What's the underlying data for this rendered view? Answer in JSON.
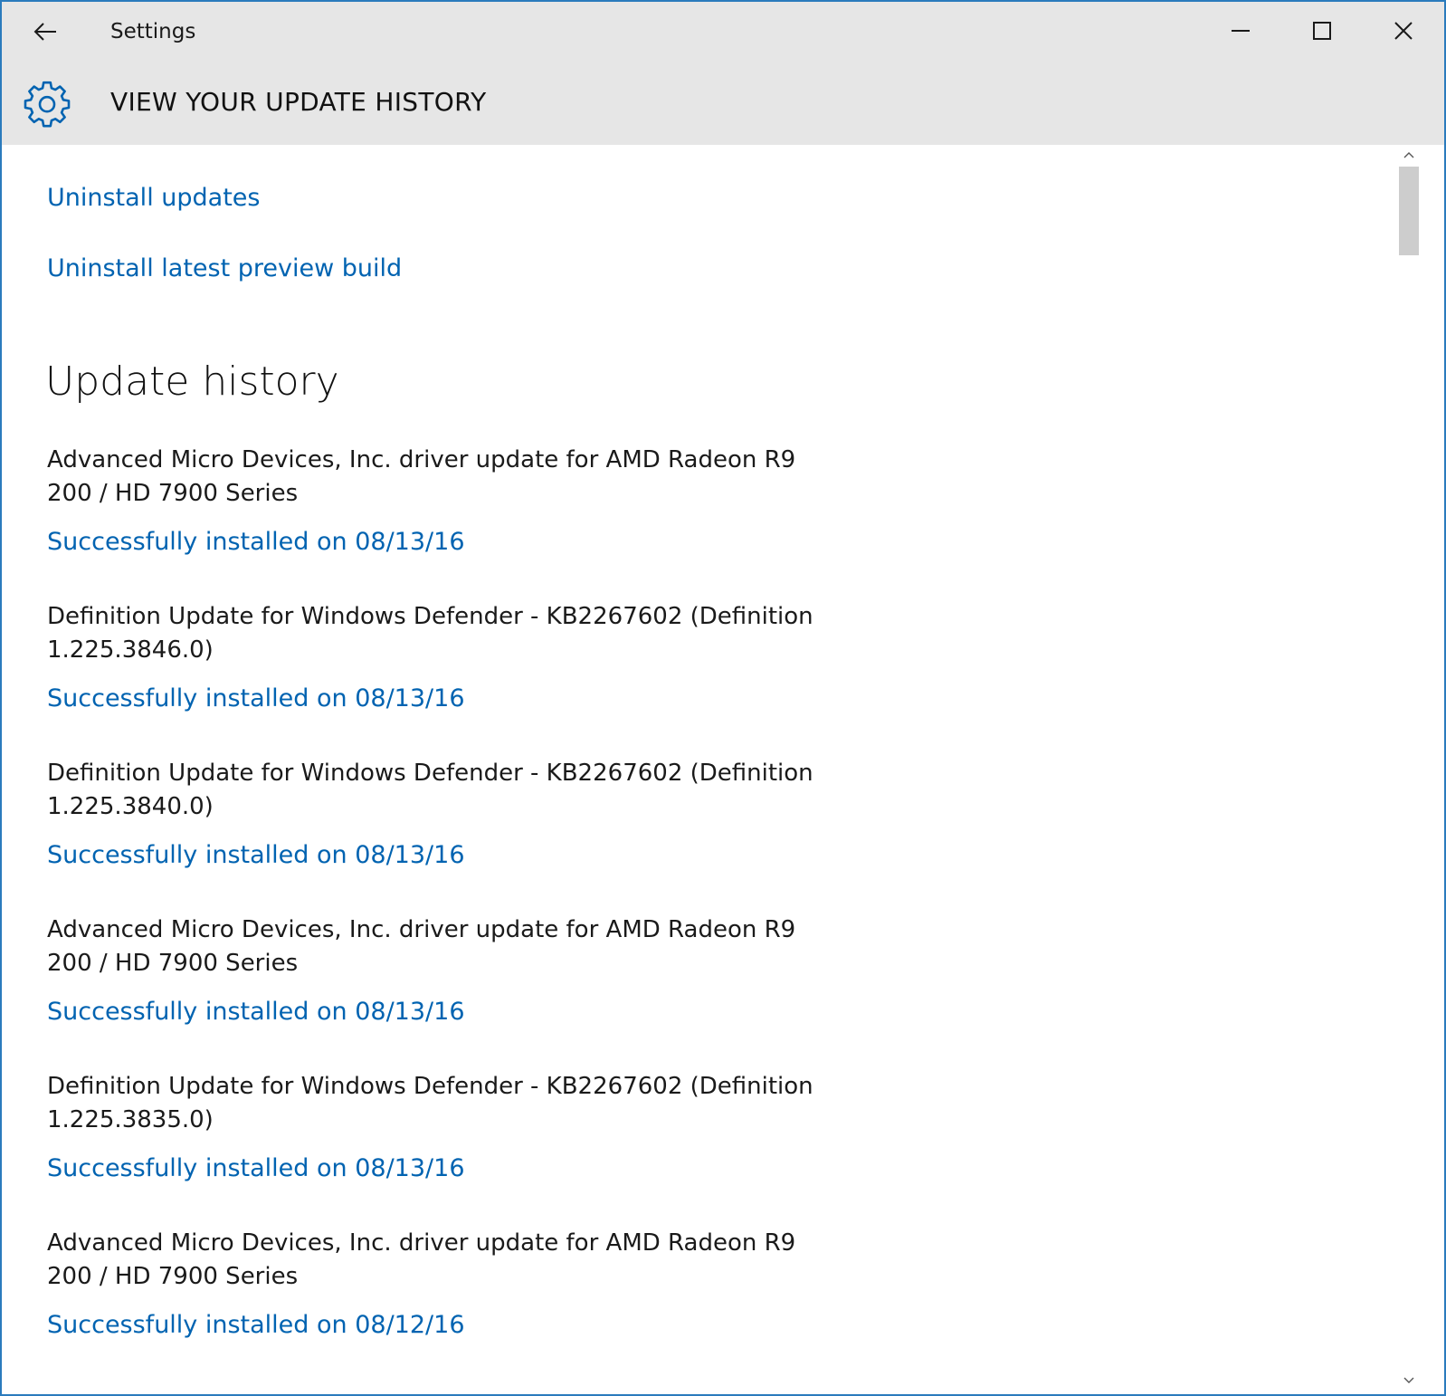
{
  "window": {
    "app_title": "Settings",
    "page_title": "VIEW YOUR UPDATE HISTORY",
    "accent_color": "#0063b1",
    "border_color": "#2b7bbd",
    "icons": {
      "back": "back-arrow-icon",
      "minimize": "minimize-icon",
      "maximize": "maximize-icon",
      "close": "close-icon",
      "header": "gear-icon"
    }
  },
  "links": {
    "uninstall_updates": "Uninstall updates",
    "uninstall_preview_build": "Uninstall latest preview build"
  },
  "history": {
    "title": "Update history",
    "items": [
      {
        "name": "Advanced Micro Devices, Inc. driver update for AMD Radeon R9 200 / HD 7900 Series",
        "status": "Successfully installed on 08/13/16"
      },
      {
        "name": "Definition Update for Windows Defender - KB2267602 (Definition 1.225.3846.0)",
        "status": "Successfully installed on 08/13/16"
      },
      {
        "name": "Definition Update for Windows Defender - KB2267602 (Definition 1.225.3840.0)",
        "status": "Successfully installed on 08/13/16"
      },
      {
        "name": "Advanced Micro Devices, Inc. driver update for AMD Radeon R9 200 / HD 7900 Series",
        "status": "Successfully installed on 08/13/16"
      },
      {
        "name": "Definition Update for Windows Defender - KB2267602 (Definition 1.225.3835.0)",
        "status": "Successfully installed on 08/13/16"
      },
      {
        "name": "Advanced Micro Devices, Inc. driver update for AMD Radeon R9 200 / HD 7900 Series",
        "status": "Successfully installed on 08/12/16"
      }
    ]
  }
}
